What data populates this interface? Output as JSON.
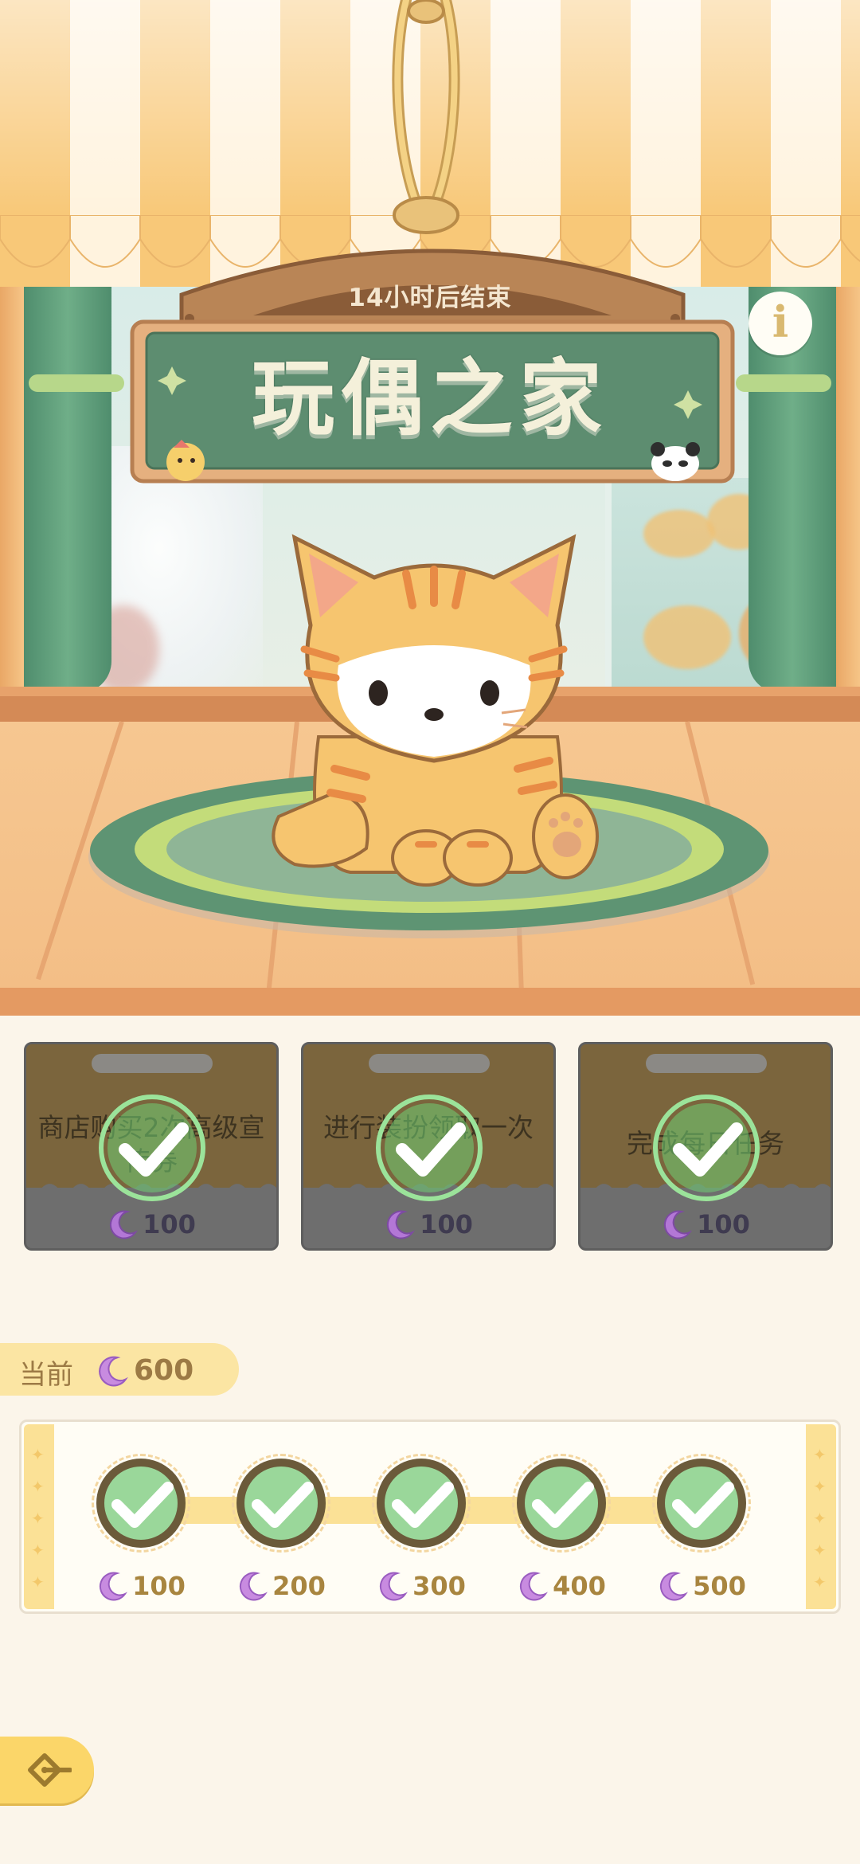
{
  "header": {
    "timer": "14小时后结束",
    "title": "玩偶之家"
  },
  "info_button": {
    "label": "i"
  },
  "tasks": [
    {
      "description": "商店购买2次高级宣传券",
      "reward": "100",
      "completed": true
    },
    {
      "description": "进行装扮领取一次",
      "reward": "100",
      "completed": true
    },
    {
      "description": "完成每日任务",
      "reward": "100",
      "completed": true
    }
  ],
  "current": {
    "label": "当前",
    "value": "600"
  },
  "milestones": [
    {
      "reward": "100",
      "completed": true
    },
    {
      "reward": "200",
      "completed": true
    },
    {
      "reward": "300",
      "completed": true
    },
    {
      "reward": "400",
      "completed": true
    },
    {
      "reward": "500",
      "completed": true
    }
  ],
  "colors": {
    "accent": "#fbd669",
    "check_green": "#8fd88a",
    "moon_purple": "#b377d6"
  },
  "icons": {
    "currency": "moon-icon",
    "complete": "check-icon",
    "back": "back-arrow-icon"
  }
}
